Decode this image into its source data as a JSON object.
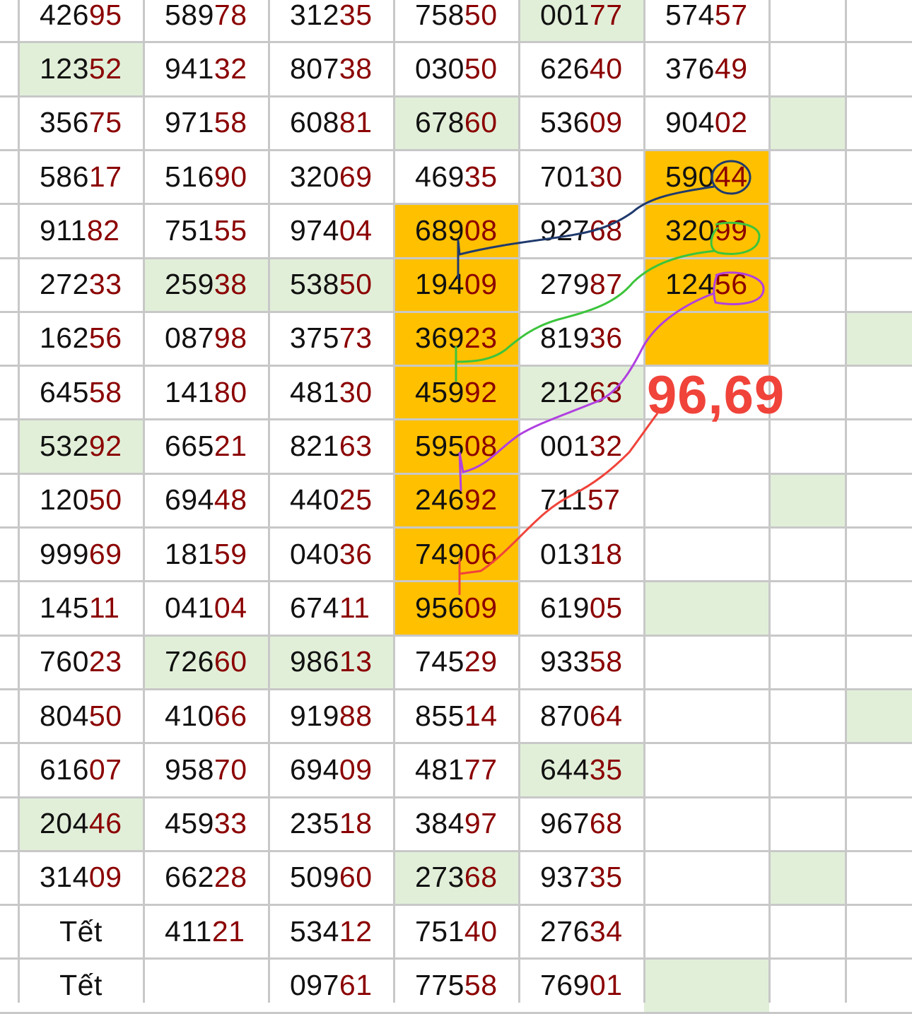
{
  "sheet": {
    "columns": [
      "c1",
      "c2",
      "c3",
      "c4",
      "c5",
      "c6",
      "c7"
    ],
    "rows": [
      [
        {
          "v": "42695"
        },
        {
          "v": "58978"
        },
        {
          "v": "31235"
        },
        {
          "v": "75850"
        },
        {
          "v": "00177",
          "hl": "green"
        },
        {
          "v": "57457"
        },
        {}
      ],
      [
        {
          "v": "12352",
          "hl": "green"
        },
        {
          "v": "94132"
        },
        {
          "v": "80738"
        },
        {
          "v": "03050"
        },
        {
          "v": "62640"
        },
        {
          "v": "37649"
        },
        {}
      ],
      [
        {
          "v": "35675"
        },
        {
          "v": "97158"
        },
        {
          "v": "60881"
        },
        {
          "v": "67860",
          "hl": "green"
        },
        {
          "v": "53609"
        },
        {
          "v": "90402"
        },
        {
          "hl": "green"
        }
      ],
      [
        {
          "v": "58617"
        },
        {
          "v": "51690"
        },
        {
          "v": "32069"
        },
        {
          "v": "46935"
        },
        {
          "v": "70130"
        },
        {
          "v": "59044",
          "hl": "orange"
        },
        {}
      ],
      [
        {
          "v": "91182"
        },
        {
          "v": "75155"
        },
        {
          "v": "97404"
        },
        {
          "v": "68908",
          "hl": "orange"
        },
        {
          "v": "92768"
        },
        {
          "v": "32099",
          "hl": "orange"
        },
        {}
      ],
      [
        {
          "v": "27233"
        },
        {
          "v": "25938",
          "hl": "green"
        },
        {
          "v": "53850",
          "hl": "green"
        },
        {
          "v": "19409",
          "hl": "orange"
        },
        {
          "v": "27987"
        },
        {
          "v": "12456",
          "hl": "orange"
        },
        {}
      ],
      [
        {
          "v": "16256"
        },
        {
          "v": "08798"
        },
        {
          "v": "37573"
        },
        {
          "v": "36923",
          "hl": "orange"
        },
        {
          "v": "81936"
        },
        {
          "hl": "orange"
        },
        {}
      ],
      [
        {
          "v": "64558"
        },
        {
          "v": "14180"
        },
        {
          "v": "48130"
        },
        {
          "v": "45992",
          "hl": "orange"
        },
        {
          "v": "21263",
          "hl": "green"
        },
        {},
        {}
      ],
      [
        {
          "v": "53292",
          "hl": "green"
        },
        {
          "v": "66521"
        },
        {
          "v": "82163"
        },
        {
          "v": "59508",
          "hl": "orange"
        },
        {
          "v": "00132"
        },
        {},
        {}
      ],
      [
        {
          "v": "12050"
        },
        {
          "v": "69448"
        },
        {
          "v": "44025"
        },
        {
          "v": "24692",
          "hl": "orange"
        },
        {
          "v": "71157"
        },
        {},
        {
          "hl": "green"
        }
      ],
      [
        {
          "v": "99969"
        },
        {
          "v": "18159"
        },
        {
          "v": "04036"
        },
        {
          "v": "74906",
          "hl": "orange"
        },
        {
          "v": "01318"
        },
        {},
        {}
      ],
      [
        {
          "v": "14511"
        },
        {
          "v": "04104"
        },
        {
          "v": "67411"
        },
        {
          "v": "95609",
          "hl": "orange"
        },
        {
          "v": "61905"
        },
        {
          "hl": "green"
        },
        {}
      ],
      [
        {
          "v": "76023"
        },
        {
          "v": "72660",
          "hl": "green"
        },
        {
          "v": "98613",
          "hl": "green"
        },
        {
          "v": "74529"
        },
        {
          "v": "93358"
        },
        {},
        {}
      ],
      [
        {
          "v": "80450"
        },
        {
          "v": "41066"
        },
        {
          "v": "91988"
        },
        {
          "v": "85514"
        },
        {
          "v": "87064"
        },
        {},
        {}
      ],
      [
        {
          "v": "61607"
        },
        {
          "v": "95870"
        },
        {
          "v": "69409"
        },
        {
          "v": "48177"
        },
        {
          "v": "64435",
          "hl": "green"
        },
        {},
        {}
      ],
      [
        {
          "v": "20446",
          "hl": "green"
        },
        {
          "v": "45933"
        },
        {
          "v": "23518"
        },
        {
          "v": "38497"
        },
        {
          "v": "96768"
        },
        {},
        {}
      ],
      [
        {
          "v": "31409"
        },
        {
          "v": "66228"
        },
        {
          "v": "50960"
        },
        {
          "v": "27368",
          "hl": "green"
        },
        {
          "v": "93735"
        },
        {},
        {
          "hl": "green"
        }
      ],
      [
        {
          "v": "Tết",
          "tet": true
        },
        {
          "v": "41121"
        },
        {
          "v": "53412"
        },
        {
          "v": "75140"
        },
        {
          "v": "27634"
        },
        {},
        {}
      ],
      [
        {
          "v": "Tết",
          "tet": true
        },
        {},
        {
          "v": "09761"
        },
        {
          "v": "77558"
        },
        {
          "v": "76901"
        },
        {
          "hl": "green"
        },
        {}
      ]
    ],
    "extra_green_right": [
      6,
      13
    ]
  },
  "annotation": {
    "text": "96,69",
    "color": "#f0433a"
  },
  "colors": {
    "head_digits": "#111111",
    "tail_digits": "#8b0000",
    "green_highlight": "#e1efd9",
    "orange_highlight": "#ffc000",
    "grid_lines": "#c8c8c8",
    "pen_blue": "#1f3a6e",
    "pen_green": "#3cc43c",
    "pen_purple": "#b040e0",
    "pen_red": "#f0433a"
  }
}
